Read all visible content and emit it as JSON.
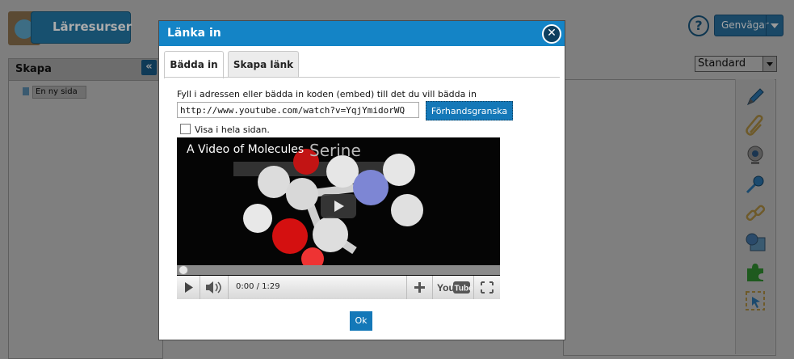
{
  "app": {
    "logo_text": "Lärresurser",
    "help_icon_char": "?",
    "shortcuts_label": "Genvägar",
    "left_panel_title": "Skapa",
    "collapse_char": "«",
    "page_item_label": "En ny sida",
    "view_select_value": "Standard",
    "tools": [
      "pencil-icon",
      "paperclip-icon",
      "webcam-icon",
      "microphone-icon",
      "chain-link-icon",
      "image-icon",
      "puzzle-piece-icon",
      "selection-icon"
    ]
  },
  "modal": {
    "title": "Länka in",
    "close_char": "✕",
    "tabs": [
      {
        "label": "Bädda in",
        "active": true
      },
      {
        "label": "Skapa länk",
        "active": false
      }
    ],
    "instruction": "Fyll i adressen eller bädda in koden (embed) till det du vill bädda in",
    "url_value": "http://www.youtube.com/watch?v=YqjYmidorWQ",
    "preview_button": "Förhandsgranska",
    "fullpage_checkbox_label": "Visa i hela sidan.",
    "fullpage_checked": false,
    "video": {
      "title": "A Video of Molecules",
      "overlay_text": "Serine",
      "time": "0:00 / 1:29",
      "progress": 0,
      "brand": "YouTube"
    },
    "ok_button": "Ok"
  },
  "colors": {
    "accent": "#1484c6",
    "button": "#1478b8",
    "overlay": "#7e7e7e"
  }
}
